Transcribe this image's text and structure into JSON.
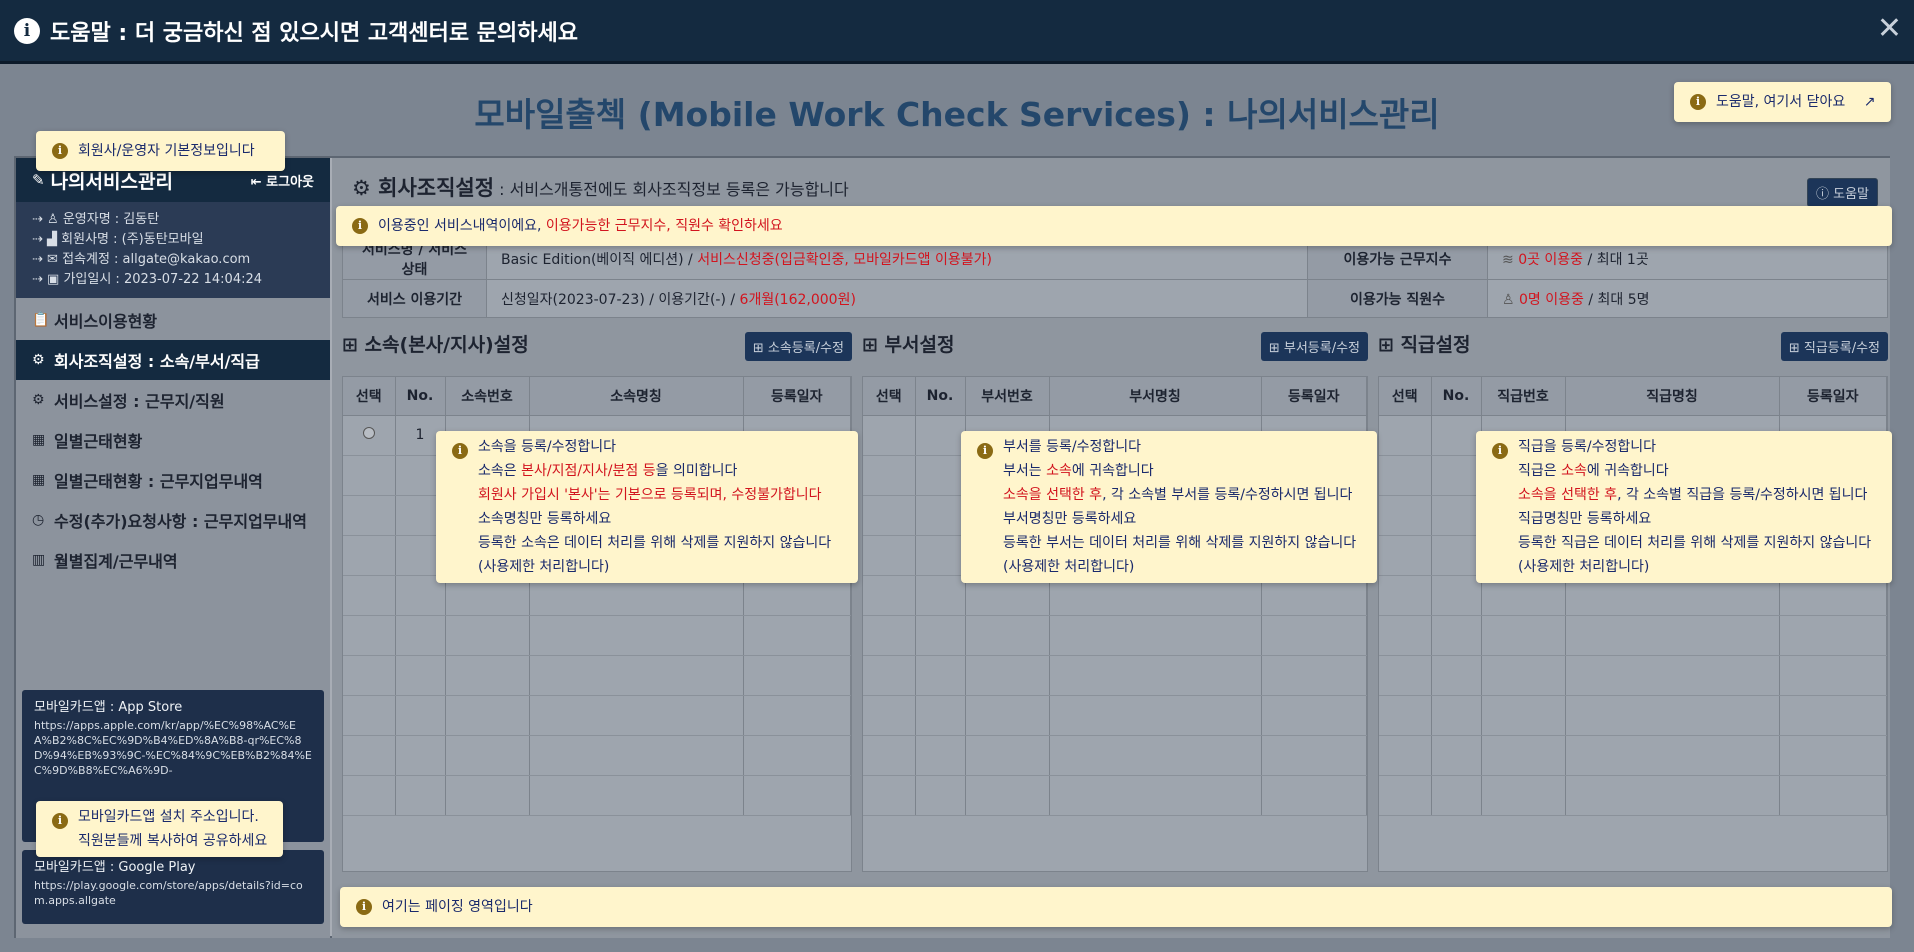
{
  "topbar": {
    "title": "도움말 : 더 궁금하신 점 있으시면 고객센터로 문의하세요",
    "close": "✕"
  },
  "page_title": "모바일출첵 (Mobile Work Check Services) : 나의서비스관리",
  "tips": {
    "close_help": "도움말, 여기서 닫아요",
    "member_info": "회원사/운영자 기본정보입니다",
    "service_notice_a": "이용중인 서비스내역이에요, ",
    "service_notice_b": "이용가능한 근무지수, 직원수 확인하세요",
    "app_line1": "모바일카드앱 설치 주소입니다.",
    "app_line2": "직원분들께 복사하여 공유하세요",
    "paging": "여기는 페이징 영역입니다"
  },
  "sidebar": {
    "title": "나의서비스관리",
    "logout": "로그아웃",
    "info": [
      "운영자명 : 김동탄",
      "회원사명 : (주)동탄모바일",
      "접속계정 : allgate@kakao.com",
      "가입일시 : 2023-07-22 14:04:24"
    ],
    "menu": [
      {
        "label": "서비스이용현황",
        "icon": "📋"
      },
      {
        "label": "회사조직설정 : 소속/부서/직급",
        "icon": "⚙"
      },
      {
        "label": "서비스설정 : 근무지/직원",
        "icon": "⚙"
      },
      {
        "label": "일별근태현황",
        "icon": "▦"
      },
      {
        "label": "일별근태현황 : 근무지업무내역",
        "icon": "▦"
      },
      {
        "label": "수정(추가)요청사항 : 근무지업무내역",
        "icon": "◷"
      },
      {
        "label": "월별집계/근무내역",
        "icon": "▥"
      }
    ],
    "appstore": {
      "title": "모바일카드앱 : App Store",
      "url": "https://apps.apple.com/kr/app/%EC%98%AC%EA%B2%8C%EC%9D%B4%ED%8A%B8-qr%EC%8D%94%EB%93%9C-%EC%84%9C%EB%B2%84%EC%9D%B8%EC%A6%9D-"
    },
    "googleplay": {
      "title": "모바일카드앱 : Google Play",
      "url": "https://play.google.com/store/apps/details?id=com.apps.allgate"
    }
  },
  "content": {
    "title": "회사조직설정",
    "subtitle": " : 서비스개통전에도 회사조직정보 등록은 가능합니다",
    "help_button": "ⓘ 도움말",
    "summary": {
      "service_label": "서비스명 / 서비스상태",
      "service_value": "Basic Edition(베이직 에디션) / ",
      "service_status": "서비스신청중(입금확인중, 모바일카드앱 이용불가)",
      "sites_label": "이용가능 근무지수",
      "sites_used": "0곳 이용중",
      "sites_max": " / 최대 1곳",
      "period_label": "서비스 이용기간",
      "period_value": "신청일자(2023-07-23) / 이용기간(-) / ",
      "period_months": "6개월(162,000원)",
      "staff_label": "이용가능 직원수",
      "staff_used": "0명 이용중",
      "staff_max": " / 최대 5명"
    },
    "affiliation": {
      "title": "소속(본사/지사)설정",
      "button": "소속등록/수정",
      "columns": [
        "선택",
        "No.",
        "소속번호",
        "소속명칭",
        "등록일자"
      ],
      "rows": [
        {
          "no": "1"
        }
      ],
      "tip": [
        "소속을 등록/수정합니다",
        "소속은 ",
        "본사/지점/지사/분점 등",
        "을 의미합니다",
        "회원사 가입시 '본사'는 기본으로 등록되며, 수정불가합니다",
        "소속명칭만 등록하세요",
        "등록한 소속은 데이터 처리를 위해 삭제를 지원하지 않습니다",
        "(사용제한 처리합니다)"
      ]
    },
    "department": {
      "title": "부서설정",
      "button": "부서등록/수정",
      "columns": [
        "선택",
        "No.",
        "부서번호",
        "부서명칭",
        "등록일자"
      ],
      "tip": [
        "부서를 등록/수정합니다",
        "부서는 ",
        "소속",
        "에 귀속합니다",
        "소속을 선택한 후",
        ", 각 소속별 부서를 등록/수정하시면 됩니다",
        "부서명칭만 등록하세요",
        "등록한 부서는 데이터 처리를 위해 삭제를 지원하지 않습니다",
        "(사용제한 처리합니다)"
      ]
    },
    "position": {
      "title": "직급설정",
      "button": "직급등록/수정",
      "columns": [
        "선택",
        "No.",
        "직급번호",
        "직급명칭",
        "등록일자"
      ],
      "tip": [
        "직급을 등록/수정합니다",
        "직급은 ",
        "소속",
        "에 귀속합니다",
        "소속을 선택한 후",
        ", 각 소속별 직급을 등록/수정하시면 됩니다",
        "직급명칭만 등록하세요",
        "등록한 직급은 데이터 처리를 위해 삭제를 지원하지 않습니다",
        "(사용제한 처리합니다)"
      ]
    }
  }
}
